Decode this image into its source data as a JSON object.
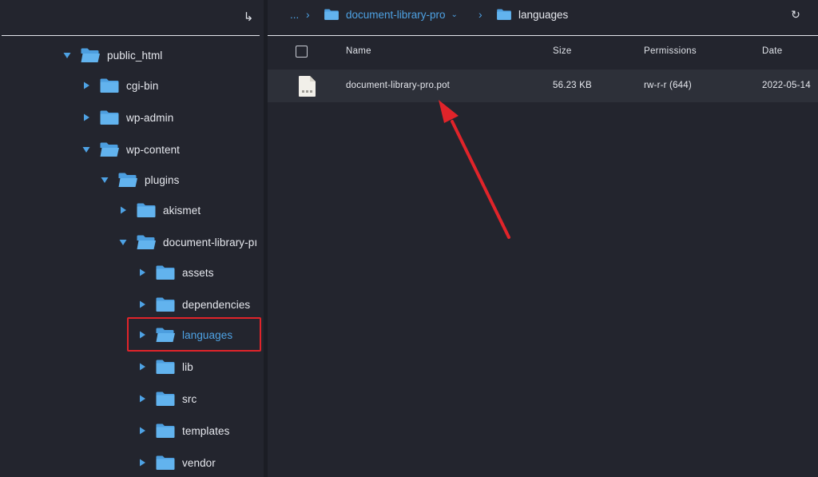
{
  "left_panel": {
    "collapse_icon": "collapse-arrow-icon",
    "tree": [
      {
        "label": "public_html",
        "expanded": true
      },
      {
        "label": "cgi-bin",
        "expanded": false
      },
      {
        "label": "wp-admin",
        "expanded": false
      },
      {
        "label": "wp-content",
        "expanded": true
      },
      {
        "label": "plugins",
        "expanded": true
      },
      {
        "label": "akismet",
        "expanded": false
      },
      {
        "label": "document-library-pı",
        "expanded": true
      },
      {
        "label": "assets",
        "expanded": false
      },
      {
        "label": "dependencies",
        "expanded": false
      },
      {
        "label": "languages",
        "expanded": false,
        "active": true
      },
      {
        "label": "lib",
        "expanded": false
      },
      {
        "label": "src",
        "expanded": false
      },
      {
        "label": "templates",
        "expanded": false
      },
      {
        "label": "vendor",
        "expanded": false
      }
    ]
  },
  "breadcrumb": {
    "ellipsis": "...",
    "items": [
      "document-library-pro",
      "languages"
    ]
  },
  "table": {
    "columns": {
      "name": "Name",
      "size": "Size",
      "permissions": "Permissions",
      "date": "Date"
    },
    "rows": [
      {
        "name": "document-library-pro.pot",
        "size": "56.23 KB",
        "permissions": "rw-r-r (644)",
        "date": "2022-05-14"
      }
    ]
  },
  "colors": {
    "background": "#23252e",
    "accent_blue": "#4ea2e4",
    "folder_blue": "#5aaee8",
    "annotation_red": "#e0242a",
    "row_highlight": "#2d3039"
  }
}
